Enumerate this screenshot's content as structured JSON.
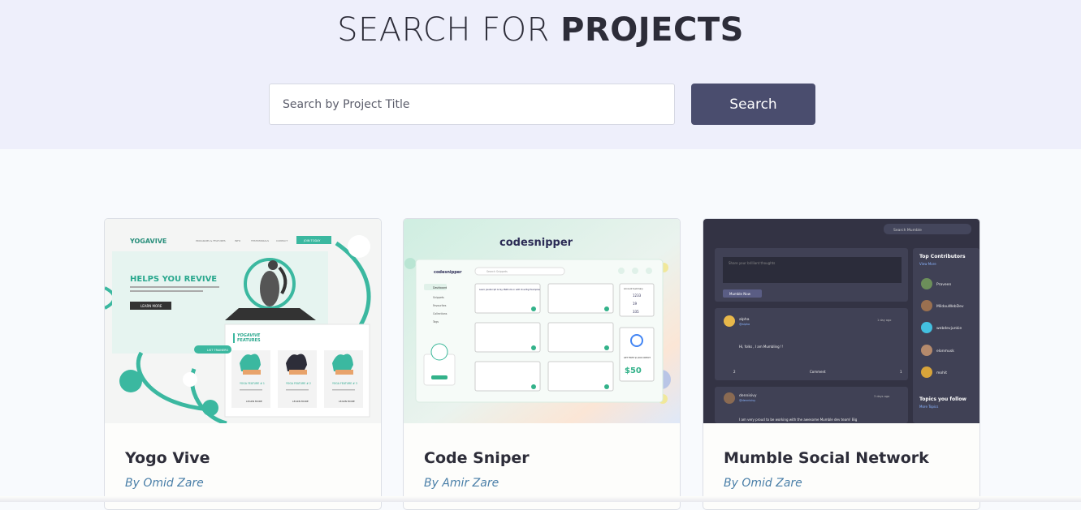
{
  "hero": {
    "title_light": "SEARCH FOR ",
    "title_bold": "PROJECTS",
    "background": "#eeeffb"
  },
  "search": {
    "placeholder": "Search by Project Title",
    "value": "",
    "button_label": "Search",
    "button_color": "#4a4d6e"
  },
  "projects": [
    {
      "title": "Yogo Vive",
      "author": "By Omid Zare",
      "thumbnail": {
        "brand": "YOGAVIVE",
        "nav": [
          "PROGRAMS & FEATURES",
          "INFO",
          "TESTIMONIALS",
          "CONTACT"
        ],
        "nav_cta": "JOIN TODAY",
        "headline": "HELPS YOU REVIVE",
        "cta": "LEARN MORE",
        "features_brand": "YOGAVIVE",
        "features_word": "FEATURES",
        "pill": "LIST TRAINERS",
        "feature_titles": [
          "YOGA FEATURE # 1",
          "YOGA FEATURE # 2",
          "YOGA FEATURE # 3"
        ],
        "feature_button": "LEARN MORE",
        "accent": "#3bb8a0"
      }
    },
    {
      "title": "Code Sniper",
      "author": "By Amir Zare",
      "thumbnail": {
        "brand": "codesnipper",
        "app_brand": "codesnipper",
        "search_placeholder": "Search Snippets",
        "sidebar": [
          "Dashboard",
          "Snippets",
          "Favourites",
          "Collections",
          "Tags"
        ],
        "snippet_title": "Learn JavaScript Array Methods in with One Big Examples",
        "card_stats_label": "Account Summary",
        "card_stats": [
          "1233",
          "19",
          "335"
        ],
        "promo_cta": "GET FREE $1,000 CREDIT",
        "promo_price": "$50",
        "accent": "#33b28a"
      }
    },
    {
      "title": "Mumble Social Network",
      "author": "By Omid Zare",
      "thumbnail": {
        "search_placeholder": "Search Mumble",
        "post_placeholder": "Share your brilliant thoughts",
        "post_button": "Mumble Now",
        "contributors_title": "Top Contributors",
        "view_more": "View More",
        "contributors": [
          "Praveen",
          "MildouWebDev",
          "webdevjunkie",
          "elonmusk",
          "mohit"
        ],
        "post1_user": "alpha",
        "post1_handle": "@alpha",
        "post1_time": "1 day ago",
        "post1_text": "Hi, folks , I am Mumbling !!",
        "post1_comments": "2",
        "post1_comment_label": "Comment",
        "post1_shares": "1",
        "post2_user": "dennisivy",
        "post2_handle": "@dennisivy",
        "post2_time": "3 days ago",
        "post2_text": "I am very proud to be working with the awesome Mumble dev team! Big",
        "topics_title": "Topics you follow",
        "more_topics": "More Topics",
        "bg": "#333344"
      }
    }
  ]
}
